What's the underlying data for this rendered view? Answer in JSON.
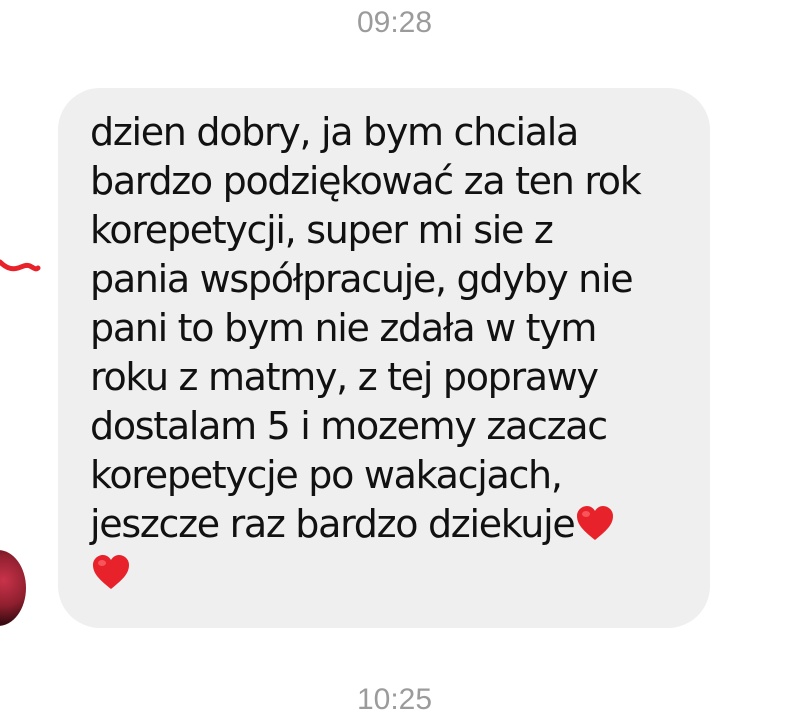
{
  "chat": {
    "timestamp_top": "09:28",
    "timestamp_bottom": "10:25",
    "message": {
      "text_lines": [
        "dzien dobry, ja bym chciala",
        "bardzo podziękować za ten rok",
        "korepetycji, super mi sie z",
        "pania współpracuje, gdyby nie",
        "pani to bym nie zdała w tym",
        "roku z matmy, z tej poprawy",
        "dostalam 5 i mozemy zaczac",
        "korepetycje po wakacjach,",
        "jeszcze raz bardzo dziekuje"
      ],
      "emoji_icon": "red-heart-icon",
      "bubble_color": "#efefef",
      "heart_color": "#e8222a"
    }
  }
}
